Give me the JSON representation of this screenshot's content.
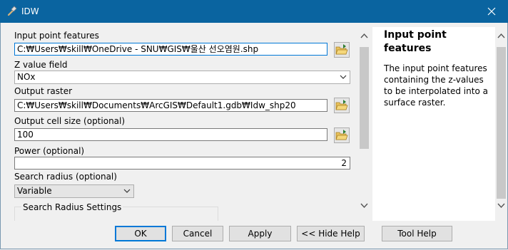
{
  "window": {
    "title": "IDW"
  },
  "form": {
    "input_features_label": "Input point features",
    "input_features_value": "C:₩Users₩skill₩OneDrive - SNU₩GIS₩울산 선오염원.shp",
    "z_field_label": "Z value field",
    "z_field_value": "NOx",
    "output_raster_label": "Output raster",
    "output_raster_value": "C:₩Users₩skill₩Documents₩ArcGIS₩Default1.gdb₩Idw_shp20",
    "cell_size_label": "Output cell size (optional)",
    "cell_size_value": "100",
    "power_label": "Power (optional)",
    "power_value": "2",
    "search_radius_label": "Search radius (optional)",
    "search_radius_value": "Variable",
    "search_radius_settings_label": "Search Radius Settings"
  },
  "help": {
    "title": "Input point features",
    "text": "The input point features containing the z-values to be interpolated into a surface raster."
  },
  "buttons": {
    "ok": "OK",
    "cancel": "Cancel",
    "apply": "Apply",
    "hide_help": "<< Hide Help",
    "tool_help": "Tool Help"
  },
  "icons": {
    "app": "hammer-icon",
    "close": "close-icon",
    "browse": "folder-open-icon"
  },
  "colors": {
    "titlebar": "#0a64a0",
    "focus_border": "#0078d7"
  }
}
